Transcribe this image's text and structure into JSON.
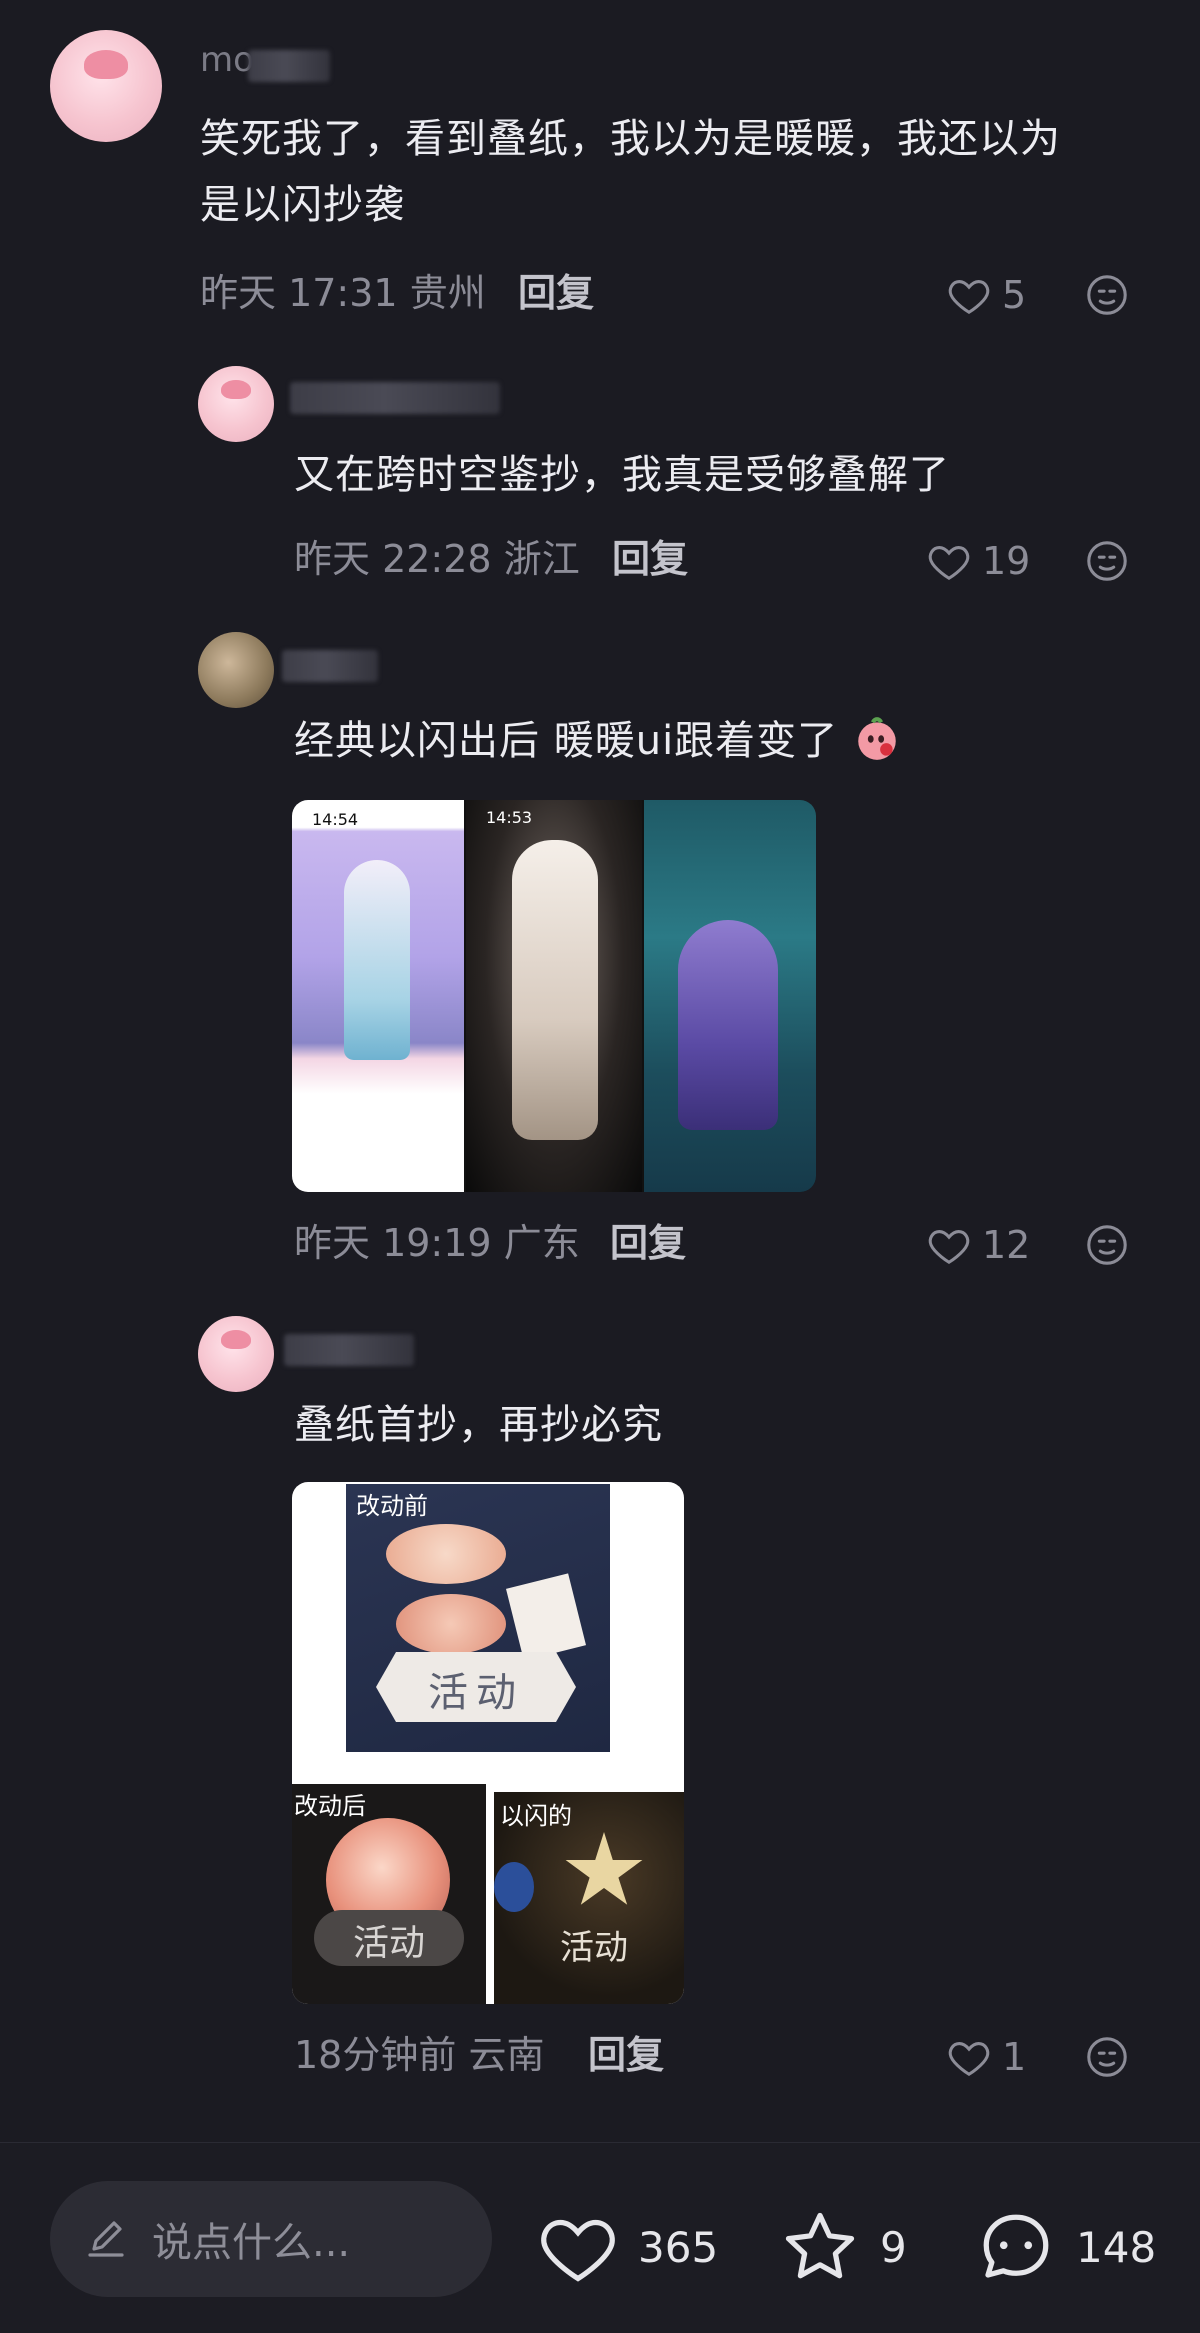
{
  "comments": [
    {
      "username_visible": "mo",
      "text_lines": [
        "笑死我了，看到叠纸，我以为是暖暖，我还以为",
        "是以闪抄袭"
      ],
      "time": "昨天 17:31",
      "location": "贵州",
      "reply_label": "回复",
      "likes": "5"
    },
    {
      "text_lines": [
        "又在跨时空鉴抄，我真是受够叠解了"
      ],
      "time": "昨天 22:28",
      "location": "浙江",
      "reply_label": "回复",
      "likes": "19"
    },
    {
      "text_lines": [
        "经典以闪出后 暖暖ui跟着变了"
      ],
      "time": "昨天 19:19",
      "location": "广东",
      "reply_label": "回复",
      "likes": "12",
      "image_texts": [
        "14:54",
        "14:53"
      ]
    },
    {
      "text_lines": [
        "叠纸首抄，再抄必究"
      ],
      "time": "18分钟前",
      "location": "云南",
      "reply_label": "回复",
      "likes": "1",
      "image_labels": {
        "before": "改动前",
        "after": "改动后",
        "other": "以闪的",
        "activity": "活动"
      }
    }
  ],
  "bottom_bar": {
    "input_placeholder": "说点什么...",
    "likes_count": "365",
    "favorites_count": "9",
    "comments_count": "148"
  },
  "icons": {
    "like": "heart-icon",
    "emoji": "face-icon",
    "favorite": "star-icon",
    "comment": "chat-bubble-icon",
    "compose": "pencil-icon"
  },
  "colors": {
    "background": "#1b1b22",
    "text": "#ececf1",
    "meta": "#8c8c97"
  }
}
